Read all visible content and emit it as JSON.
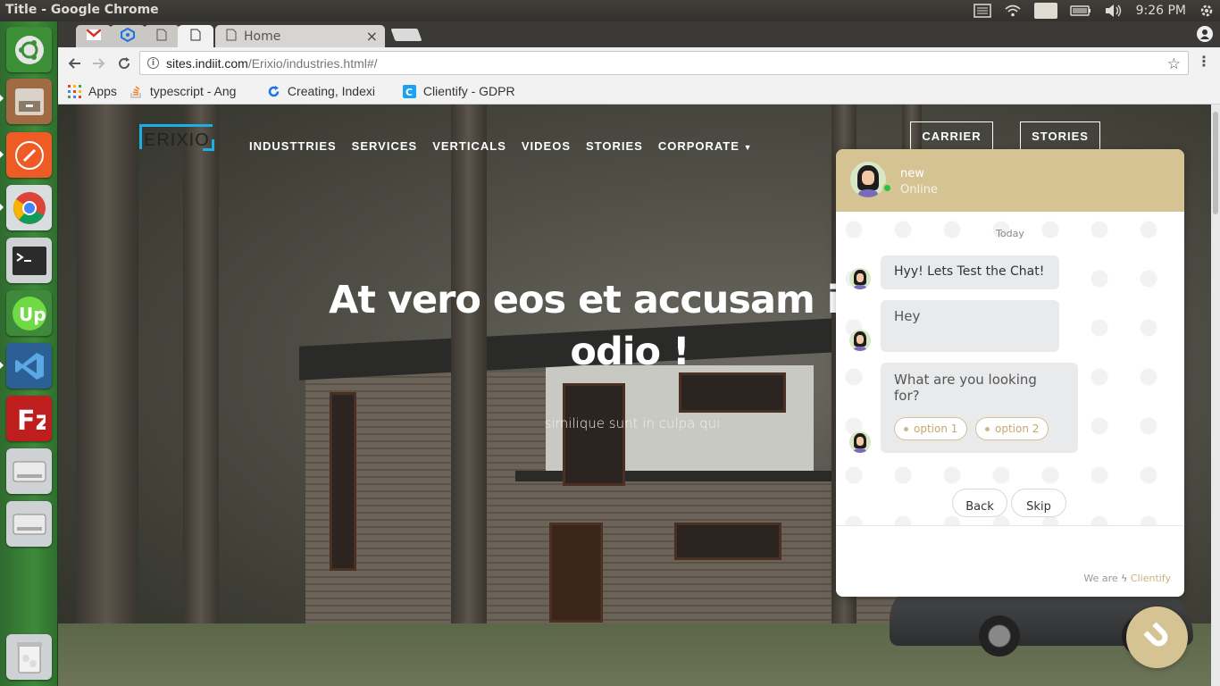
{
  "window": {
    "title": "Title - Google Chrome"
  },
  "system_tray": {
    "language": "En",
    "clock": "9:26 PM"
  },
  "launcher": {
    "items": [
      {
        "name": "ubuntu-dash",
        "color": "#3f9b3a"
      },
      {
        "name": "files",
        "color": "#b97f4f"
      },
      {
        "name": "postman",
        "color": "#ef5b25"
      },
      {
        "name": "google-chrome",
        "color": "#5f9fd0"
      },
      {
        "name": "terminal",
        "color": "#2b2b2b"
      },
      {
        "name": "upwork",
        "color": "#6fda44"
      },
      {
        "name": "vscode",
        "color": "#2c5f93"
      },
      {
        "name": "filezilla",
        "color": "#bf1e1e"
      },
      {
        "name": "drive-1",
        "color": "#cfd2d4"
      },
      {
        "name": "drive-2",
        "color": "#cfd2d4"
      },
      {
        "name": "trash",
        "color": "#cfd2d4"
      }
    ]
  },
  "browser": {
    "tabs": [
      {
        "label": "",
        "icon": "gmail-icon"
      },
      {
        "label": "",
        "icon": "hex-icon"
      },
      {
        "label": "",
        "icon": "page-icon"
      },
      {
        "label": "",
        "icon": "page-icon"
      },
      {
        "label": "Home",
        "icon": "page-icon"
      }
    ],
    "url_host": "sites.indiit.com",
    "url_path": "/Erixio/industries.html#/",
    "bookmarks": [
      {
        "label": "Apps",
        "icon": "apps-grid-icon"
      },
      {
        "label": "typescript - Ang",
        "icon": "stackoverflow-icon"
      },
      {
        "label": "Creating, Indexi",
        "icon": "refresh-blue-icon"
      },
      {
        "label": "Clientify - GDPR",
        "icon": "clientify-icon"
      }
    ]
  },
  "site": {
    "logo": "ERIXIO",
    "nav": [
      "INDUSTTRIES",
      "SERVICES",
      "VERTICALS",
      "VIDEOS",
      "STORIES",
      "CORPORATE"
    ],
    "buttons": {
      "carrier": "CARRIER",
      "stories": "STORIES"
    },
    "hero_title": "At vero eos et accusam iusto odio !",
    "hero_subtitle": "similique sunt in culpa qui"
  },
  "chat": {
    "agent_name": "new",
    "agent_status": "Online",
    "date_label": "Today",
    "messages": [
      "Hyy! Lets Test the Chat!",
      "Hey",
      "What are you looking for?"
    ],
    "quick_replies": [
      "option 1",
      "option 2"
    ],
    "nav_buttons": {
      "back": "Back",
      "skip": "Skip"
    },
    "powered_prefix": "We are",
    "powered_brand": "Clientify",
    "accent_color": "#d6c393"
  }
}
